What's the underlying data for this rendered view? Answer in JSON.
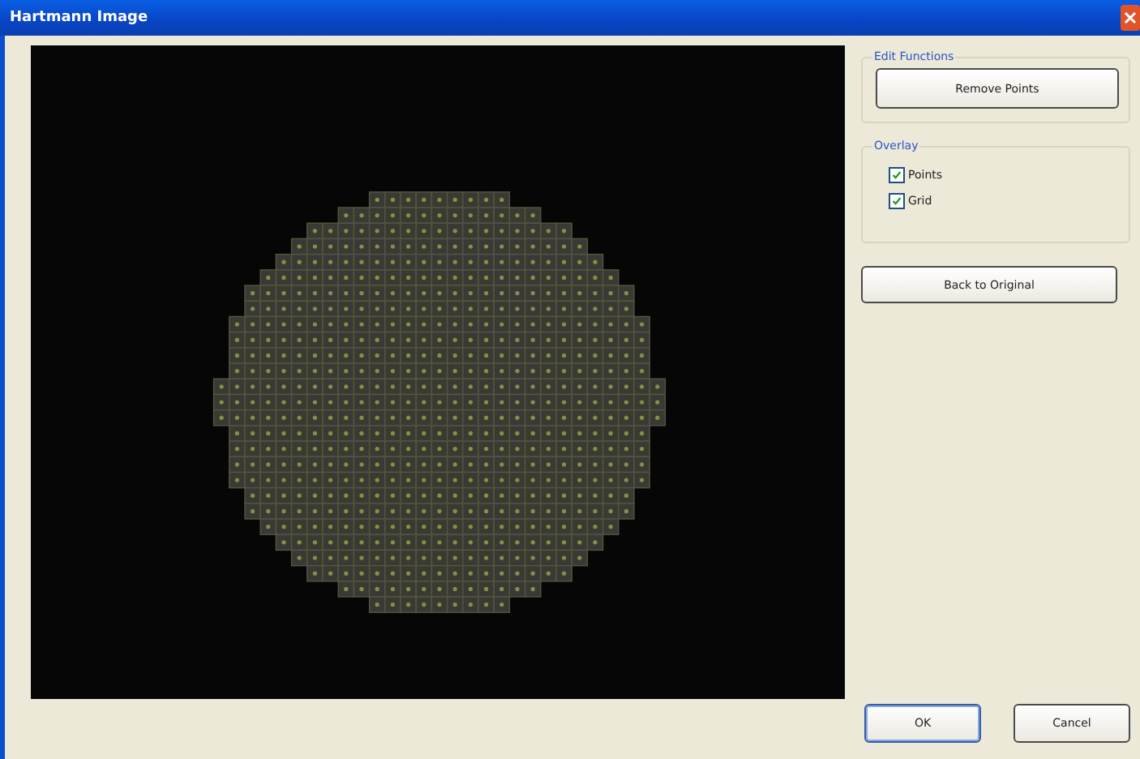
{
  "window": {
    "title": "Hartmann Image"
  },
  "edit_functions": {
    "title": "Edit Functions",
    "button": "Remove Points"
  },
  "overlay": {
    "title": "Overlay",
    "items": [
      {
        "label": "Points",
        "checked": true
      },
      {
        "label": "Grid",
        "checked": true
      }
    ]
  },
  "back_button": "Back to Original",
  "buttons": [
    {
      "label": "OK",
      "default": true
    },
    {
      "label": "Cancel",
      "default": false
    }
  ]
}
